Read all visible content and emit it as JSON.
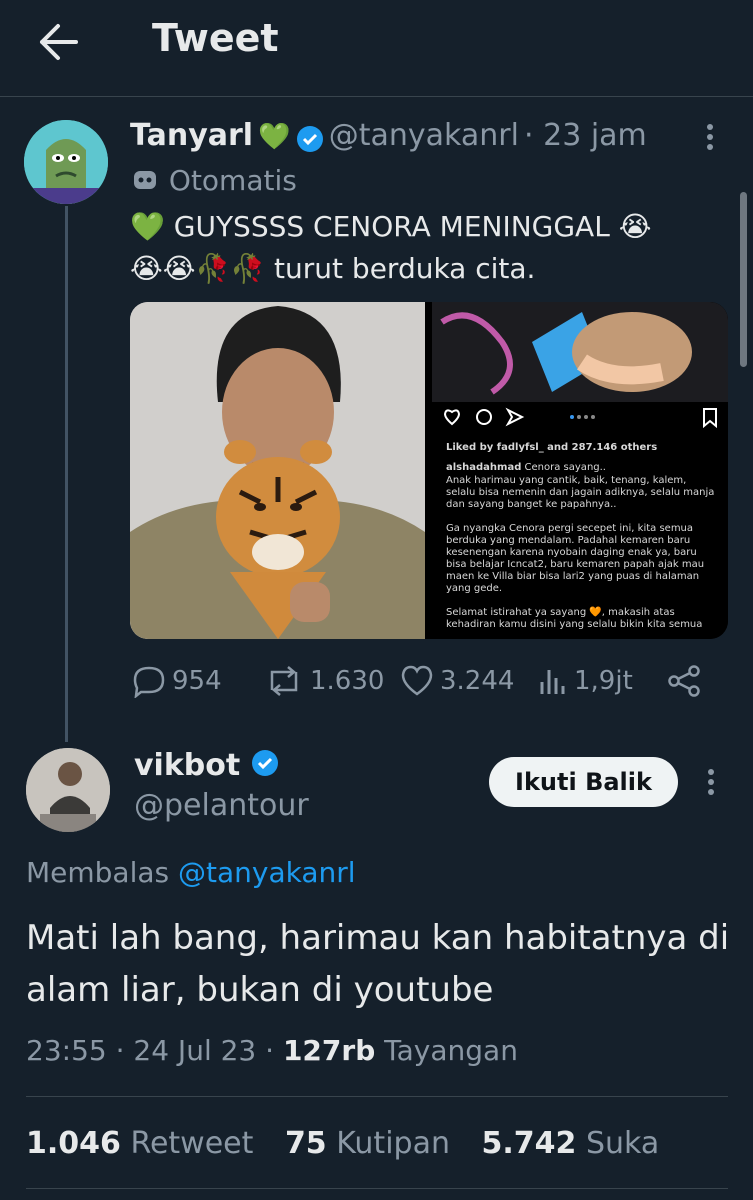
{
  "header": {
    "title": "Tweet"
  },
  "tweet": {
    "author_name": "Tanyarl",
    "author_heart": "💚",
    "author_handle": "@tanyakanrl",
    "time": "· 23 jam",
    "label": "Otomatis",
    "text_line1": "💚 GUYSSSS CENORA MENINGGAL 😭",
    "text_line2": "😭😭🥀🥀 turut berduka cita.",
    "instagram": {
      "liked_by": "Liked by fadlyfsl_ and 287.146 others",
      "username": "alshadahmad",
      "caption_first": "Cenora sayang..",
      "caption_lines": [
        "Anak harimau yang cantik, baik, tenang, kalem,",
        "selalu bisa nemenin dan jagain adiknya, selalu manja",
        "dan sayang banget ke papahnya..",
        "",
        "Ga nyangka Cenora pergi secepet ini, kita semua",
        "berduka yang mendalam. Padahal kemaren baru",
        "kesenengan karena nyobain daging enak ya, baru",
        "bisa belajar Icncat2, baru kemaren papah ajak mau",
        "maen ke Villa biar bisa lari2 yang puas di halaman",
        "yang gede.",
        "",
        "Selamat istirahat ya sayang 🧡, makasih atas",
        "kehadiran kamu disini yang selalu bikin kita semua"
      ]
    },
    "stats": {
      "replies": "954",
      "retweets": "1.630",
      "likes": "3.244",
      "views": "1,9jt"
    }
  },
  "reply": {
    "author_name": "vikbot",
    "author_handle": "@pelantour",
    "follow_label": "Ikuti Balik",
    "replying_prefix": "Membalas",
    "replying_to": "@tanyakanrl",
    "text": "Mati lah bang, harimau kan habitatnya di alam liar, bukan di youtube",
    "time": "23:55",
    "date": "24 Jul 23",
    "views_count": "127rb",
    "views_label": "Tayangan",
    "retweets_count": "1.046",
    "retweets_label": "Retweet",
    "quotes_count": "75",
    "quotes_label": "Kutipan",
    "likes_count": "5.742",
    "likes_label": "Suka"
  },
  "colors": {
    "background": "#15202b",
    "accent": "#1d9bf0",
    "muted": "#8b98a5",
    "verified": "#1d9bf0"
  }
}
